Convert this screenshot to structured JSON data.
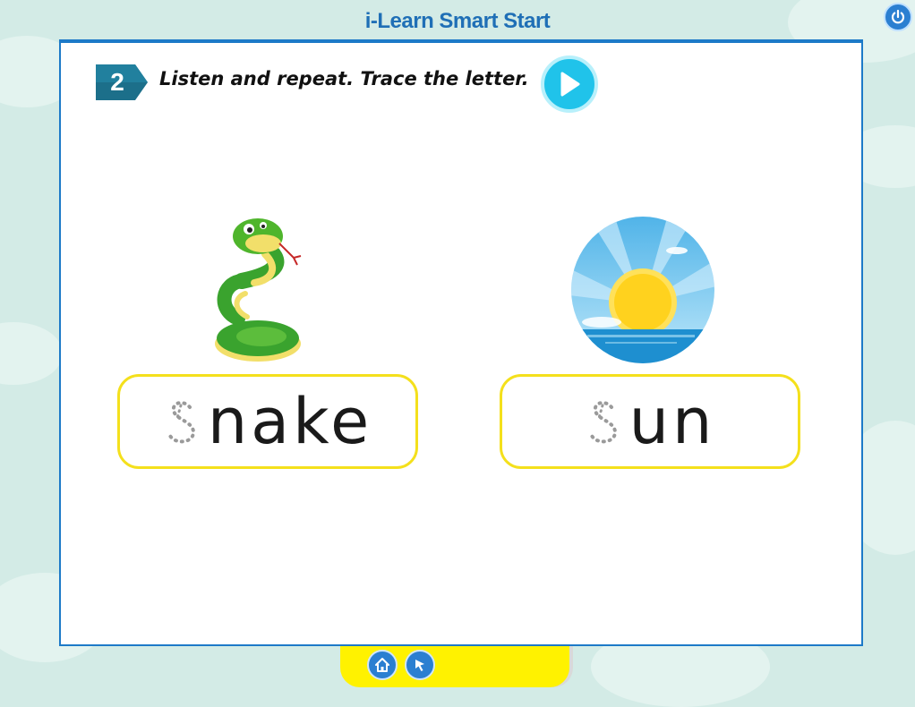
{
  "app": {
    "title": "i-Learn Smart Start"
  },
  "exercise": {
    "number": "2",
    "instruction": "Listen and repeat. Trace the letter."
  },
  "cards": [
    {
      "picture": "snake-picture",
      "trace_letter": "s",
      "word_rest": "nake"
    },
    {
      "picture": "sun-picture",
      "trace_letter": "s",
      "word_rest": "un"
    }
  ],
  "icons": {
    "power": "power-icon",
    "play": "play-icon",
    "home": "home-icon",
    "pointer": "pointer-icon"
  },
  "colors": {
    "background": "#d3ebe6",
    "title": "#1f6fb6",
    "stage_border": "#1d7ac8",
    "badge": "#1c6f8a",
    "play": "#20c3ea",
    "word_box_border": "#f4e01c",
    "bottom_bar": "#fff200"
  }
}
